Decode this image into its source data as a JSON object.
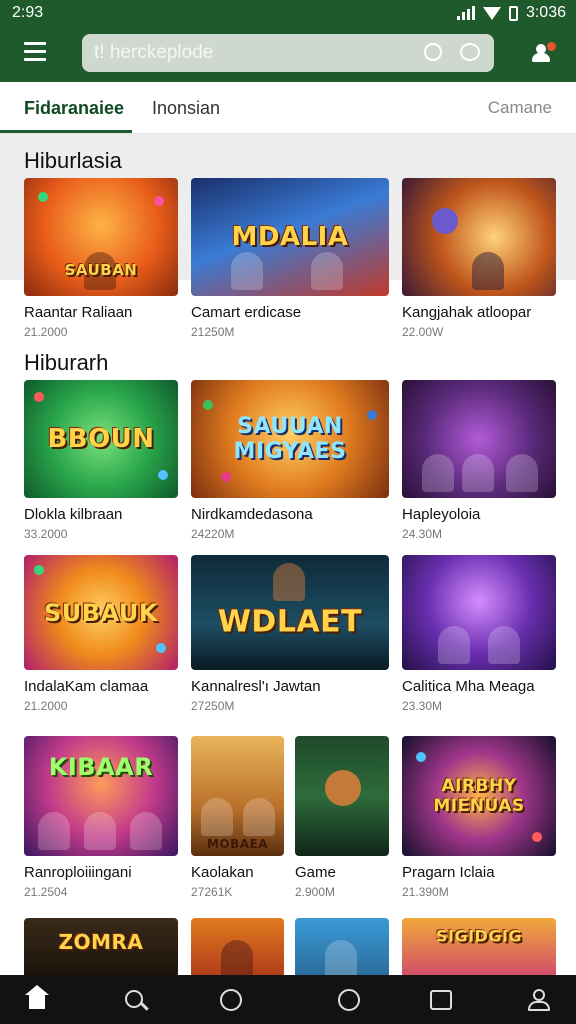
{
  "status_bar": {
    "time": "2:93",
    "clock_right": "3:036"
  },
  "search": {
    "text": "t! herckeplode"
  },
  "tabs": [
    {
      "label": "Fidaranaiee",
      "active": true
    },
    {
      "label": "Inonsian",
      "active": false
    },
    {
      "label": "Camane",
      "active": false
    }
  ],
  "sections": [
    {
      "title": "Hiburlasia"
    },
    {
      "title": "Hiburarh"
    }
  ],
  "games": [
    {
      "logo": "SAUBAN",
      "name": "Raantar Raliaan",
      "meta": "21.2000"
    },
    {
      "logo": "MDALIA",
      "name": "Camart erdicase",
      "meta": "21250M"
    },
    {
      "logo": "",
      "name": "Kangjahak atloopar",
      "meta": "22.00W"
    },
    {
      "logo": "BBOUN",
      "name": "Dlokla kilbraan",
      "meta": "33.2000"
    },
    {
      "logo": "SAUUAN MIGYAES",
      "name": "Nirdkamdedasona",
      "meta": "24220M"
    },
    {
      "logo": "",
      "name": "Hapleyoloia",
      "meta": "24.30M"
    },
    {
      "logo": "SUBAUK",
      "name": "IndalaKam clamaa",
      "meta": "21.2000"
    },
    {
      "logo": "WDLAET",
      "name": "Kannalresl'ı Jawtan",
      "meta": "27250M"
    },
    {
      "logo": "",
      "name": "Calitica Mha Meaga",
      "meta": "23.30M"
    },
    {
      "logo": "KIBAAR",
      "name": "Ranroploiiingani",
      "meta": "21.2504"
    },
    {
      "logo": "MOBAEA",
      "name": "Kaolakan",
      "meta": "27261K"
    },
    {
      "logo": "",
      "name": "Game",
      "meta": "2.900M"
    },
    {
      "logo": "AIRBHY MIENUAS",
      "name": "Pragarn Iclaia",
      "meta": "21.390M"
    },
    {
      "logo": "ZOMRA",
      "name": "",
      "meta": ""
    },
    {
      "logo": "",
      "name": "",
      "meta": ""
    },
    {
      "logo": "",
      "name": "",
      "meta": ""
    },
    {
      "logo": "SIGIDGIG",
      "name": "",
      "meta": ""
    }
  ],
  "colors": {
    "app_bar": "#1e5a2c",
    "accent": "#1e5a2c",
    "bottom_nav": "#121212"
  },
  "bottom_nav": [
    "home-icon",
    "search-icon",
    "explore-icon",
    "games-icon",
    "chart-icon",
    "profile-icon"
  ]
}
